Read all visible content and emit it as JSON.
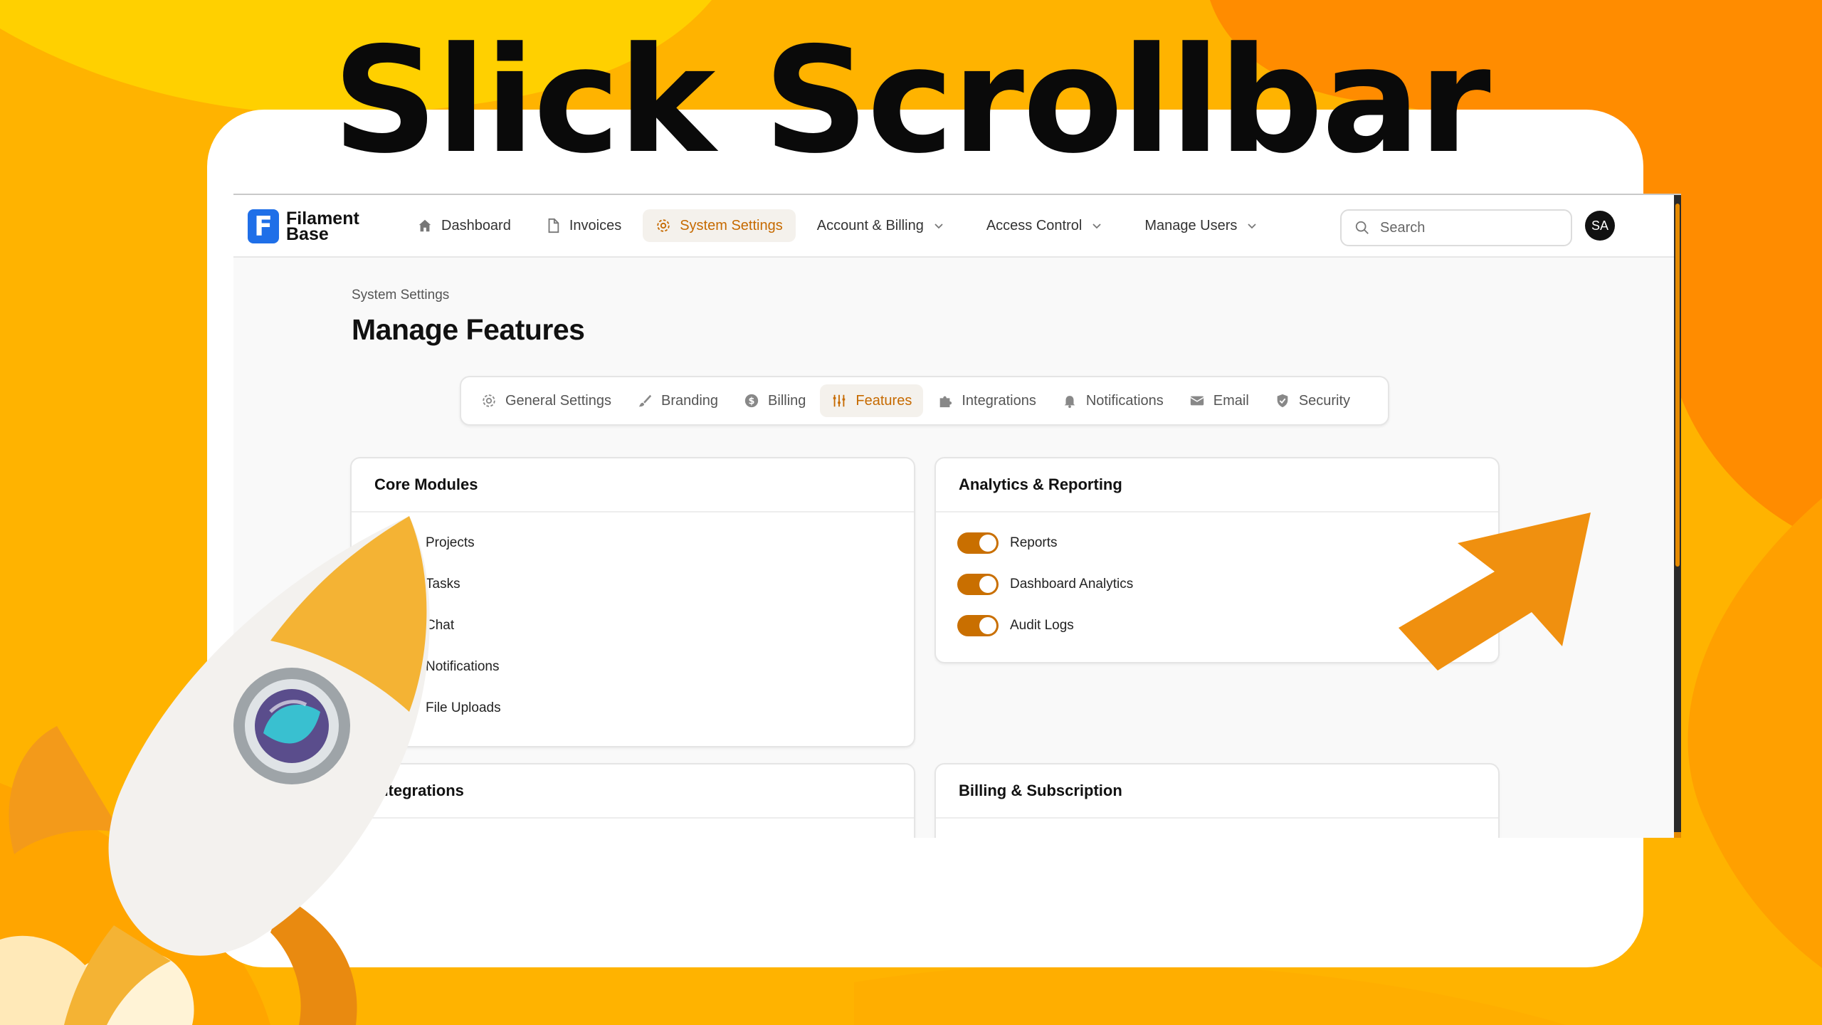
{
  "headline": "Slick Scrollbar",
  "colors": {
    "accent": "#c96f00",
    "background": "#ffb300",
    "arrow": "#f0900f"
  },
  "logo": {
    "line1": "Filament",
    "line2": "Base",
    "mark": "F"
  },
  "nav": {
    "items": [
      {
        "label": "Dashboard",
        "icon": "home-icon"
      },
      {
        "label": "Invoices",
        "icon": "document-icon"
      },
      {
        "label": "System Settings",
        "icon": "gear-icon",
        "active": true
      },
      {
        "label": "Account & Billing",
        "dropdown": true
      },
      {
        "label": "Access Control",
        "dropdown": true
      },
      {
        "label": "Manage Users",
        "dropdown": true
      }
    ]
  },
  "search": {
    "placeholder": "Search"
  },
  "avatar": "SA",
  "breadcrumb": "System Settings",
  "page_title": "Manage Features",
  "tabs": [
    {
      "label": "General Settings",
      "icon": "gear-icon"
    },
    {
      "label": "Branding",
      "icon": "brush-icon"
    },
    {
      "label": "Billing",
      "icon": "dollar-icon"
    },
    {
      "label": "Features",
      "icon": "sliders-icon",
      "active": true
    },
    {
      "label": "Integrations",
      "icon": "puzzle-icon"
    },
    {
      "label": "Notifications",
      "icon": "bell-icon"
    },
    {
      "label": "Email",
      "icon": "envelope-icon"
    },
    {
      "label": "Security",
      "icon": "shield-icon"
    }
  ],
  "panels": {
    "core": {
      "title": "Core Modules",
      "items": [
        "Projects",
        "Tasks",
        "Chat",
        "Notifications",
        "File Uploads"
      ]
    },
    "analytics": {
      "title": "Analytics & Reporting",
      "items": [
        "Reports",
        "Dashboard Analytics",
        "Audit Logs"
      ]
    },
    "integrations": {
      "title": "Integrations"
    },
    "billing": {
      "title": "Billing & Subscription"
    }
  }
}
